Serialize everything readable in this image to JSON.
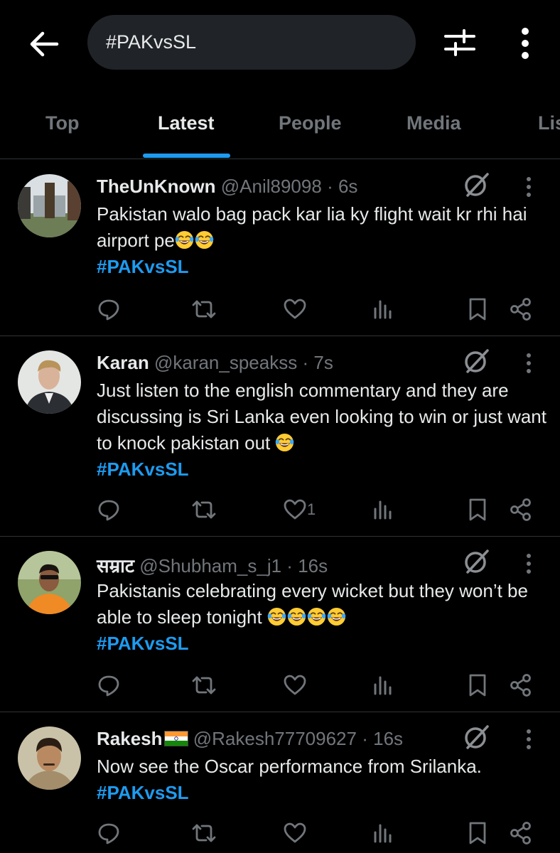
{
  "search": {
    "query": "#PAKvsSL"
  },
  "tabs": [
    "Top",
    "Latest",
    "People",
    "Media",
    "Lis"
  ],
  "active_tab": "Latest",
  "colors": {
    "accent": "#1d9bf0",
    "background": "#000000",
    "muted": "#71767b",
    "text": "#e7e9ea"
  },
  "tweets": [
    {
      "name": "TheUnKnown",
      "handle": "@Anil89098",
      "time": "6s",
      "text": "Pakistan walo bag pack kar lia ky flight wait kr rhi hai airport pe",
      "emoji_count": 2,
      "hashtag": "#PAKvsSL",
      "likes": ""
    },
    {
      "name": "Karan",
      "handle": "@karan_speakss",
      "time": "7s",
      "text": "Just listen to the english commentary and they are discussing is Sri Lanka even looking to win or just want to knock pakistan out ",
      "emoji_count": 1,
      "hashtag": "#PAKvsSL",
      "likes": "1"
    },
    {
      "name": "सम्राट",
      "handle": "@Shubham_s_j1",
      "time": "16s",
      "text": "Pakistanis celebrating every wicket but they won’t be able to sleep tonight ",
      "emoji_count": 4,
      "hashtag": "#PAKvsSL",
      "likes": ""
    },
    {
      "name": "Rakesh",
      "handle": "@Rakesh77709627",
      "time": "16s",
      "text": "Now see the Oscar performance from Srilanka.",
      "emoji_count": 0,
      "hashtag": "#PAKvsSL",
      "likes": ""
    }
  ]
}
